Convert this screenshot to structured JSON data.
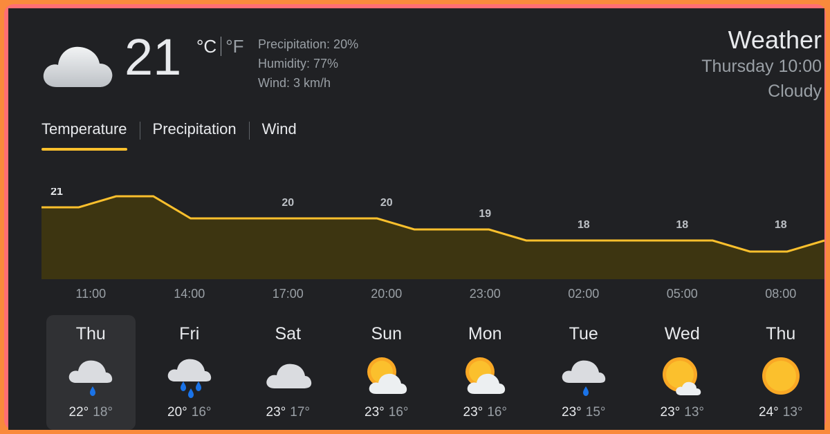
{
  "current": {
    "icon": "cloud-icon",
    "temperature": "21",
    "unit_c": "°C",
    "unit_f": "°F",
    "precipitation": "Precipitation: 20%",
    "humidity": "Humidity: 77%",
    "wind": "Wind: 3 km/h"
  },
  "header": {
    "title": "Weather",
    "datetime": "Thursday 10:00",
    "condition": "Cloudy"
  },
  "tabs": [
    {
      "label": "Temperature",
      "active": true
    },
    {
      "label": "Precipitation",
      "active": false
    },
    {
      "label": "Wind",
      "active": false
    }
  ],
  "hours": [
    "11:00",
    "14:00",
    "17:00",
    "20:00",
    "23:00",
    "02:00",
    "05:00",
    "08:00"
  ],
  "chart_data": {
    "type": "area",
    "series": [
      {
        "values": [
          21,
          21,
          22,
          22,
          20,
          20,
          20,
          20,
          20,
          20,
          19,
          19,
          19,
          18,
          18,
          18,
          18,
          18,
          18,
          17,
          17,
          18
        ]
      }
    ],
    "labels": [
      {
        "hour": "11:00",
        "value": "21"
      },
      {
        "hour": "14:00",
        "value": "22"
      },
      {
        "hour": "17:00",
        "value": "20"
      },
      {
        "hour": "20:00",
        "value": "20"
      },
      {
        "hour": "23:00",
        "value": "19"
      },
      {
        "hour": "02:00",
        "value": "18"
      },
      {
        "hour": "05:00",
        "value": "18"
      },
      {
        "hour": "08:00",
        "value": "18"
      }
    ],
    "line_color": "#fbc02d",
    "fill_color": "#3d3511"
  },
  "days": [
    {
      "name": "Thu",
      "icon": "rain-cloud-icon",
      "high": "22°",
      "low": "18°",
      "selected": true
    },
    {
      "name": "Fri",
      "icon": "heavy-rain-cloud-icon",
      "high": "20°",
      "low": "16°",
      "selected": false
    },
    {
      "name": "Sat",
      "icon": "cloud-icon",
      "high": "23°",
      "low": "17°",
      "selected": false
    },
    {
      "name": "Sun",
      "icon": "partly-cloudy-icon",
      "high": "23°",
      "low": "16°",
      "selected": false
    },
    {
      "name": "Mon",
      "icon": "partly-cloudy-icon",
      "high": "23°",
      "low": "16°",
      "selected": false
    },
    {
      "name": "Tue",
      "icon": "rain-cloud-icon",
      "high": "23°",
      "low": "15°",
      "selected": false
    },
    {
      "name": "Wed",
      "icon": "mostly-sunny-icon",
      "high": "23°",
      "low": "13°",
      "selected": false
    },
    {
      "name": "Thu",
      "icon": "sun-icon",
      "high": "24°",
      "low": "13°",
      "selected": false
    }
  ],
  "colors": {
    "background": "#202124",
    "accent": "#fbc02d",
    "text": "#e8eaed",
    "muted": "#9aa0a6",
    "selected_day": "#303134",
    "frame": "#f98a3c"
  }
}
